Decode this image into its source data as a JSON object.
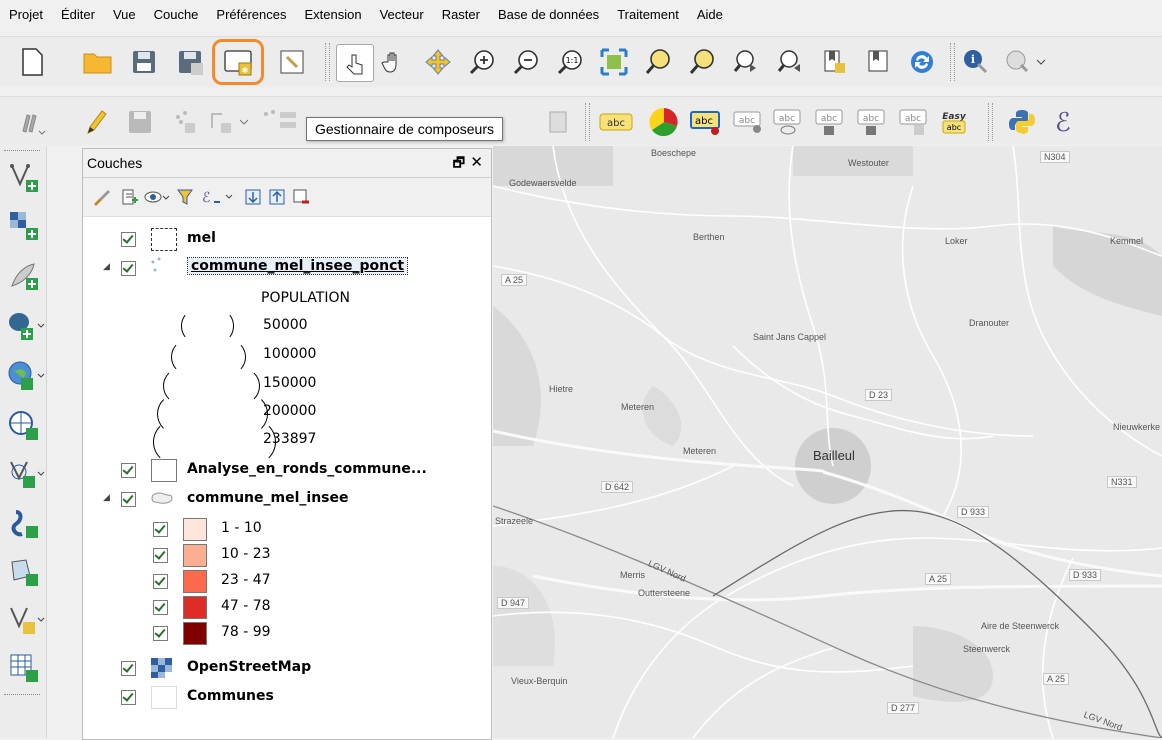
{
  "menu": [
    "Projet",
    "Éditer",
    "Vue",
    "Couche",
    "Préférences",
    "Extension",
    "Vecteur",
    "Raster",
    "Base de données",
    "Traitement",
    "Aide"
  ],
  "tooltip": "Gestionnaire de composeurs",
  "highlight_color": "#f28a2e",
  "toolbar2_labels": {
    "abc": "abc",
    "easy_top": "Easy",
    "easy_bottom": "abc"
  },
  "layers_panel": {
    "title": "Couches",
    "float_icon": "🗗",
    "close_icon": "✕",
    "layers": {
      "mel": "mel",
      "ponct": "commune_mel_insee_ponct",
      "analyse": "Analyse_en_ronds_commune...",
      "insee": "commune_mel_insee",
      "osm": "OpenStreetMap",
      "communes": "Communes"
    },
    "population_legend": {
      "title": "POPULATION",
      "values": [
        "50000",
        "100000",
        "150000",
        "200000",
        "233897"
      ]
    },
    "choropleth": [
      {
        "label": "1 - 10",
        "color": "#fee5d9"
      },
      {
        "label": "10 - 23",
        "color": "#fcae91"
      },
      {
        "label": "23 - 47",
        "color": "#fb6a4a"
      },
      {
        "label": "47 - 78",
        "color": "#de2d26"
      },
      {
        "label": "78 - 99",
        "color": "#800000"
      }
    ]
  },
  "map": {
    "labels": {
      "boeschepe": "Boeschepe",
      "westouter": "Westouter",
      "n304": "N304",
      "godewaersvelde": "Godewaersvelde",
      "berthen": "Berthen",
      "loker": "Loker",
      "kemmel": "Kemmel",
      "a25_top": "A 25",
      "saint_jans": "Saint Jans Cappel",
      "dranouter": "Dranouter",
      "hietre": "Hietre",
      "d23": "D 23",
      "meteren_small": "Meteren",
      "meteren": "Meteren",
      "bailleul": "Bailleul",
      "nieuwkerke": "Nieuwkerke",
      "d642": "D 642",
      "n331": "N331",
      "strazeele": "Strazeele",
      "d933": "D 933",
      "merris": "Merris",
      "outtersteene": "Outtersteene",
      "d947": "D 947",
      "a25_mid": "A 25",
      "d933b": "D 933",
      "steenwerck": "Steenwerck",
      "aire": "Aire de Steenwerck",
      "vieux_berquin": "Vieux-Berquin",
      "a25_low": "A 25",
      "d277": "D 277",
      "lgv_nord": "LGV Nord",
      "sgv_nord": "LGV Nord"
    }
  }
}
